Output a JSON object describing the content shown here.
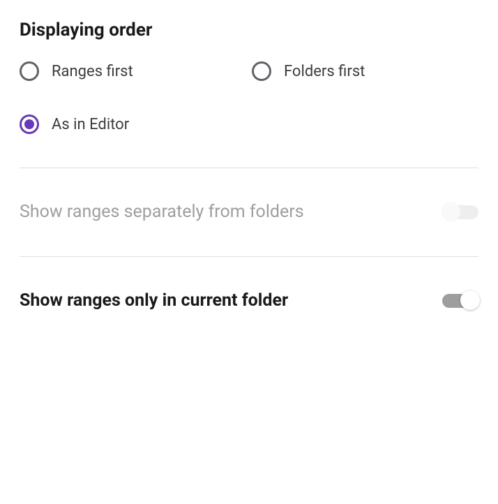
{
  "section_title": "Displaying order",
  "radios": {
    "ranges_first": "Ranges first",
    "folders_first": "Folders first",
    "as_in_editor": "As in Editor",
    "selected": "as_in_editor"
  },
  "toggles": {
    "show_separately": {
      "label": "Show ranges separately from folders",
      "enabled": false,
      "value": false
    },
    "show_current_only": {
      "label": "Show ranges only in current folder",
      "enabled": true,
      "value": true
    }
  },
  "colors": {
    "accent": "#673ab7",
    "text": "#1a1a1a",
    "muted": "#9e9e9e",
    "divider": "#e0e0e0"
  }
}
